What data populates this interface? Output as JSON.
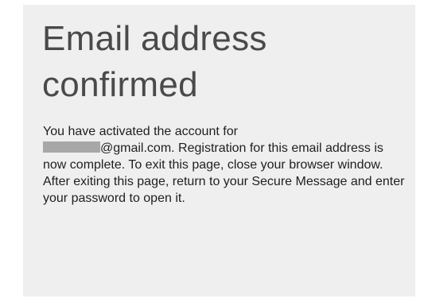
{
  "heading": {
    "line1": "Email address",
    "line2": "confirmed"
  },
  "message": {
    "part1": "You have activated the account for",
    "email_suffix": "@gmail.com.",
    "part2": " Registration for this email address is now complete. To exit this page, close your browser window. After exiting this page, return to your Secure Message and enter your password to open it."
  },
  "colors": {
    "panel_background": "#efefef",
    "heading_text": "#4a4a4a",
    "body_text": "#1f1f1f",
    "redaction": "#a7a7a7"
  }
}
